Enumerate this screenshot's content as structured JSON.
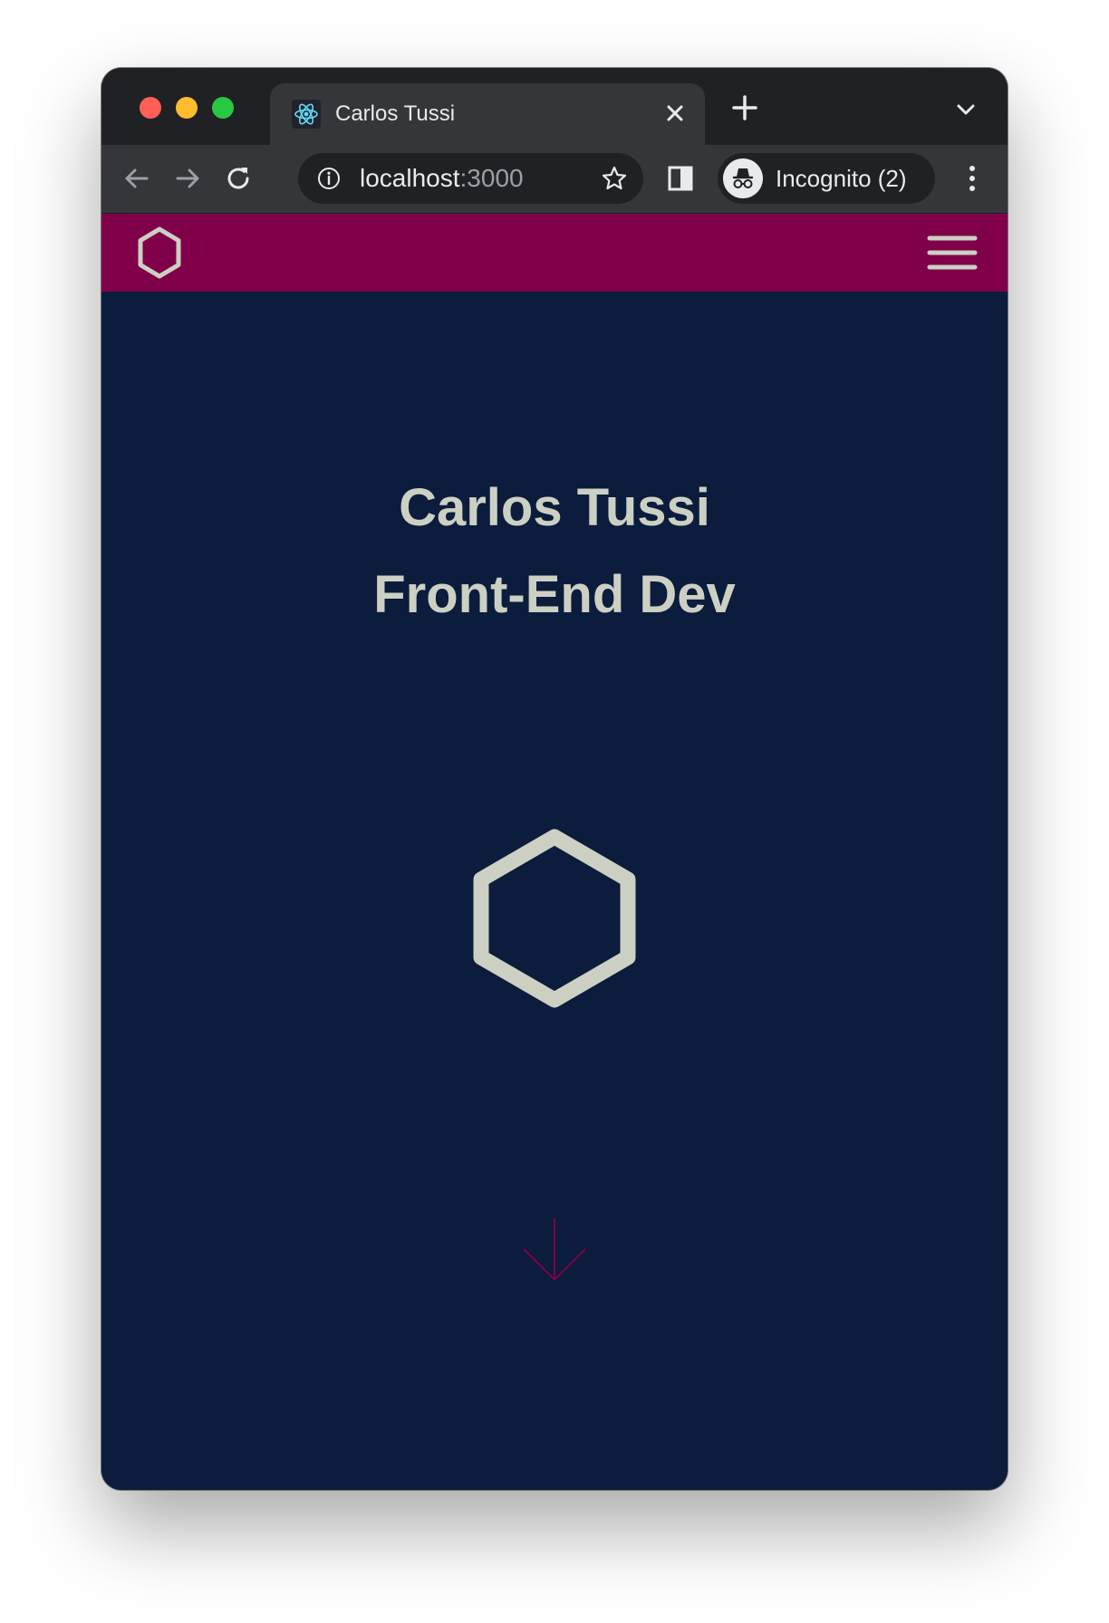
{
  "browser": {
    "tab": {
      "title": "Carlos Tussi",
      "favicon": "react-icon"
    },
    "omnibox": {
      "host": "localhost",
      "port": ":3000"
    },
    "profile": {
      "label": "Incognito (2)"
    },
    "colors": {
      "frame": "#202124",
      "toolbar": "#35363a",
      "text": "#e8eaed"
    }
  },
  "site": {
    "navbar": {
      "logo": "hexagon-logo-icon",
      "menu": "hamburger-menu-icon",
      "color": "#80004a"
    },
    "hero": {
      "name": "Carlos Tussi",
      "role": "Front-End Dev",
      "logo": "hexagon-logo-icon",
      "scroll": "arrow-down-icon"
    },
    "colors": {
      "background": "#0b1c3c",
      "text": "#ccd0c3",
      "accent": "#80004a"
    }
  }
}
